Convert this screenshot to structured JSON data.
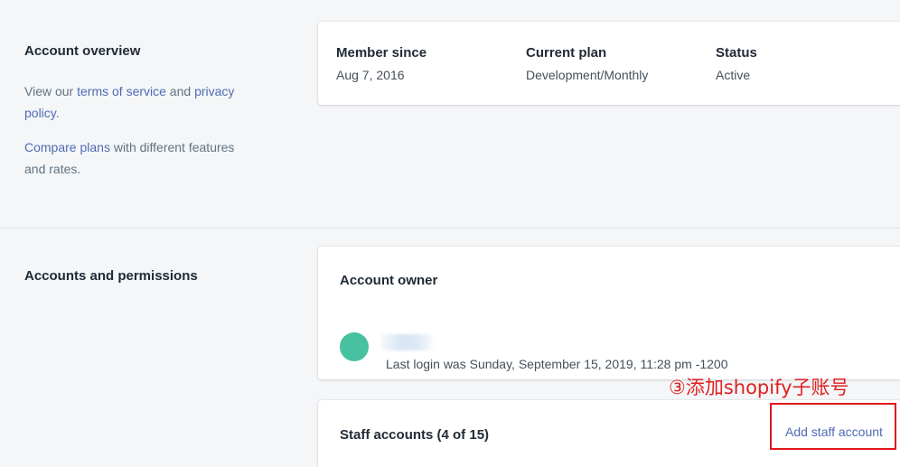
{
  "overview": {
    "title": "Account overview",
    "terms_prefix": "View our ",
    "terms_link": "terms of service",
    "terms_and": " and ",
    "privacy_link": "privacy policy",
    "terms_suffix": ".",
    "compare_link": "Compare plans",
    "compare_suffix": " with different features and rates.",
    "card": {
      "member_since_label": "Member since",
      "member_since_value": "Aug 7, 2016",
      "plan_label": "Current plan",
      "plan_value": "Development/Monthly",
      "status_label": "Status",
      "status_value": "Active"
    }
  },
  "accounts": {
    "title": "Accounts and permissions",
    "owner_card": {
      "title": "Account owner",
      "last_login": "Last login was Sunday, September 15, 2019, 11:28 pm -1200"
    },
    "staff_card": {
      "title": "Staff accounts (4 of 15)",
      "add_link": "Add staff account"
    },
    "annotation": "③添加shopify子账号"
  },
  "colors": {
    "link": "#4f6bb3",
    "avatar": "#47c1a0",
    "annotation_red": "#e02020"
  }
}
